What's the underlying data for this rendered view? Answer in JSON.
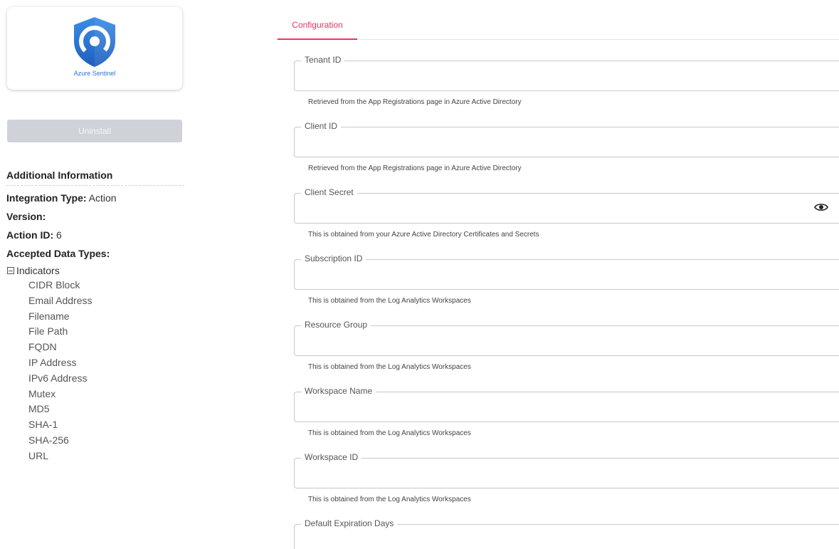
{
  "logo": {
    "text": "Azure Sentinel",
    "icon": "azure-sentinel-shield-icon",
    "color": "#2a6fd6"
  },
  "uninstall_label": "Uninstall",
  "info": {
    "title": "Additional Information",
    "integration_type_label": "Integration Type:",
    "integration_type_value": "Action",
    "version_label": "Version:",
    "version_value": "",
    "action_id_label": "Action ID:",
    "action_id_value": "6",
    "accepted_data_types_label": "Accepted Data Types:",
    "indicators_label": "Indicators",
    "indicator_types": [
      "CIDR Block",
      "Email Address",
      "Filename",
      "File Path",
      "FQDN",
      "IP Address",
      "IPv6 Address",
      "Mutex",
      "MD5",
      "SHA-1",
      "SHA-256",
      "URL"
    ]
  },
  "tabs": [
    {
      "label": "Configuration",
      "active": true
    }
  ],
  "accent_color": "#e8365f",
  "fields": [
    {
      "label": "Tenant ID",
      "value": "",
      "helper": "Retrieved from the App Registrations page in Azure Active Directory"
    },
    {
      "label": "Client ID",
      "value": "",
      "helper": "Retrieved from the App Registrations page in Azure Active Directory"
    },
    {
      "label": "Client Secret",
      "value": "",
      "helper": "This is obtained from your Azure Active Directory Certificates and Secrets",
      "icon": "eye-icon"
    },
    {
      "label": "Subscription ID",
      "value": "",
      "helper": "This is obtained from the Log Analytics Workspaces"
    },
    {
      "label": "Resource Group",
      "value": "",
      "helper": "This is obtained from the Log Analytics Workspaces"
    },
    {
      "label": "Workspace Name",
      "value": "",
      "helper": "This is obtained from the Log Analytics Workspaces"
    },
    {
      "label": "Workspace ID",
      "value": "",
      "helper": "This is obtained from the Log Analytics Workspaces"
    },
    {
      "label": "Default Expiration Days",
      "value": ""
    }
  ]
}
